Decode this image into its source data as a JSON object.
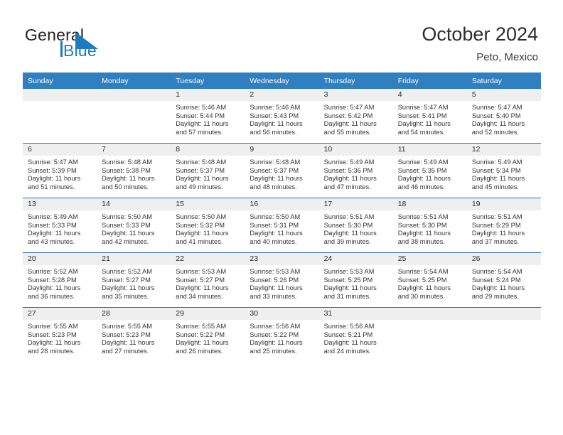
{
  "brand": {
    "name_part1": "General",
    "name_part2": "Blue",
    "logo_icon": "triangle-flag-icon"
  },
  "header": {
    "title": "October 2024",
    "subtitle": "Peto, Mexico"
  },
  "colors": {
    "header_band": "#2f7fc1",
    "row_divider": "#2f6fb0",
    "daynum_band": "#efefef",
    "brand_blue": "#1f7bc1",
    "text": "#2b2b2b"
  },
  "calendar": {
    "weekday_headers": [
      "Sunday",
      "Monday",
      "Tuesday",
      "Wednesday",
      "Thursday",
      "Friday",
      "Saturday"
    ],
    "weeks": [
      [
        {
          "day": "",
          "lines": []
        },
        {
          "day": "",
          "lines": []
        },
        {
          "day": "1",
          "lines": [
            "Sunrise: 5:46 AM",
            "Sunset: 5:44 PM",
            "Daylight: 11 hours",
            "and 57 minutes."
          ]
        },
        {
          "day": "2",
          "lines": [
            "Sunrise: 5:46 AM",
            "Sunset: 5:43 PM",
            "Daylight: 11 hours",
            "and 56 minutes."
          ]
        },
        {
          "day": "3",
          "lines": [
            "Sunrise: 5:47 AM",
            "Sunset: 5:42 PM",
            "Daylight: 11 hours",
            "and 55 minutes."
          ]
        },
        {
          "day": "4",
          "lines": [
            "Sunrise: 5:47 AM",
            "Sunset: 5:41 PM",
            "Daylight: 11 hours",
            "and 54 minutes."
          ]
        },
        {
          "day": "5",
          "lines": [
            "Sunrise: 5:47 AM",
            "Sunset: 5:40 PM",
            "Daylight: 11 hours",
            "and 52 minutes."
          ]
        }
      ],
      [
        {
          "day": "6",
          "lines": [
            "Sunrise: 5:47 AM",
            "Sunset: 5:39 PM",
            "Daylight: 11 hours",
            "and 51 minutes."
          ]
        },
        {
          "day": "7",
          "lines": [
            "Sunrise: 5:48 AM",
            "Sunset: 5:38 PM",
            "Daylight: 11 hours",
            "and 50 minutes."
          ]
        },
        {
          "day": "8",
          "lines": [
            "Sunrise: 5:48 AM",
            "Sunset: 5:37 PM",
            "Daylight: 11 hours",
            "and 49 minutes."
          ]
        },
        {
          "day": "9",
          "lines": [
            "Sunrise: 5:48 AM",
            "Sunset: 5:37 PM",
            "Daylight: 11 hours",
            "and 48 minutes."
          ]
        },
        {
          "day": "10",
          "lines": [
            "Sunrise: 5:49 AM",
            "Sunset: 5:36 PM",
            "Daylight: 11 hours",
            "and 47 minutes."
          ]
        },
        {
          "day": "11",
          "lines": [
            "Sunrise: 5:49 AM",
            "Sunset: 5:35 PM",
            "Daylight: 11 hours",
            "and 46 minutes."
          ]
        },
        {
          "day": "12",
          "lines": [
            "Sunrise: 5:49 AM",
            "Sunset: 5:34 PM",
            "Daylight: 11 hours",
            "and 45 minutes."
          ]
        }
      ],
      [
        {
          "day": "13",
          "lines": [
            "Sunrise: 5:49 AM",
            "Sunset: 5:33 PM",
            "Daylight: 11 hours",
            "and 43 minutes."
          ]
        },
        {
          "day": "14",
          "lines": [
            "Sunrise: 5:50 AM",
            "Sunset: 5:33 PM",
            "Daylight: 11 hours",
            "and 42 minutes."
          ]
        },
        {
          "day": "15",
          "lines": [
            "Sunrise: 5:50 AM",
            "Sunset: 5:32 PM",
            "Daylight: 11 hours",
            "and 41 minutes."
          ]
        },
        {
          "day": "16",
          "lines": [
            "Sunrise: 5:50 AM",
            "Sunset: 5:31 PM",
            "Daylight: 11 hours",
            "and 40 minutes."
          ]
        },
        {
          "day": "17",
          "lines": [
            "Sunrise: 5:51 AM",
            "Sunset: 5:30 PM",
            "Daylight: 11 hours",
            "and 39 minutes."
          ]
        },
        {
          "day": "18",
          "lines": [
            "Sunrise: 5:51 AM",
            "Sunset: 5:30 PM",
            "Daylight: 11 hours",
            "and 38 minutes."
          ]
        },
        {
          "day": "19",
          "lines": [
            "Sunrise: 5:51 AM",
            "Sunset: 5:29 PM",
            "Daylight: 11 hours",
            "and 37 minutes."
          ]
        }
      ],
      [
        {
          "day": "20",
          "lines": [
            "Sunrise: 5:52 AM",
            "Sunset: 5:28 PM",
            "Daylight: 11 hours",
            "and 36 minutes."
          ]
        },
        {
          "day": "21",
          "lines": [
            "Sunrise: 5:52 AM",
            "Sunset: 5:27 PM",
            "Daylight: 11 hours",
            "and 35 minutes."
          ]
        },
        {
          "day": "22",
          "lines": [
            "Sunrise: 5:53 AM",
            "Sunset: 5:27 PM",
            "Daylight: 11 hours",
            "and 34 minutes."
          ]
        },
        {
          "day": "23",
          "lines": [
            "Sunrise: 5:53 AM",
            "Sunset: 5:26 PM",
            "Daylight: 11 hours",
            "and 33 minutes."
          ]
        },
        {
          "day": "24",
          "lines": [
            "Sunrise: 5:53 AM",
            "Sunset: 5:25 PM",
            "Daylight: 11 hours",
            "and 31 minutes."
          ]
        },
        {
          "day": "25",
          "lines": [
            "Sunrise: 5:54 AM",
            "Sunset: 5:25 PM",
            "Daylight: 11 hours",
            "and 30 minutes."
          ]
        },
        {
          "day": "26",
          "lines": [
            "Sunrise: 5:54 AM",
            "Sunset: 5:24 PM",
            "Daylight: 11 hours",
            "and 29 minutes."
          ]
        }
      ],
      [
        {
          "day": "27",
          "lines": [
            "Sunrise: 5:55 AM",
            "Sunset: 5:23 PM",
            "Daylight: 11 hours",
            "and 28 minutes."
          ]
        },
        {
          "day": "28",
          "lines": [
            "Sunrise: 5:55 AM",
            "Sunset: 5:23 PM",
            "Daylight: 11 hours",
            "and 27 minutes."
          ]
        },
        {
          "day": "29",
          "lines": [
            "Sunrise: 5:55 AM",
            "Sunset: 5:22 PM",
            "Daylight: 11 hours",
            "and 26 minutes."
          ]
        },
        {
          "day": "30",
          "lines": [
            "Sunrise: 5:56 AM",
            "Sunset: 5:22 PM",
            "Daylight: 11 hours",
            "and 25 minutes."
          ]
        },
        {
          "day": "31",
          "lines": [
            "Sunrise: 5:56 AM",
            "Sunset: 5:21 PM",
            "Daylight: 11 hours",
            "and 24 minutes."
          ]
        },
        {
          "day": "",
          "lines": []
        },
        {
          "day": "",
          "lines": []
        }
      ]
    ]
  }
}
